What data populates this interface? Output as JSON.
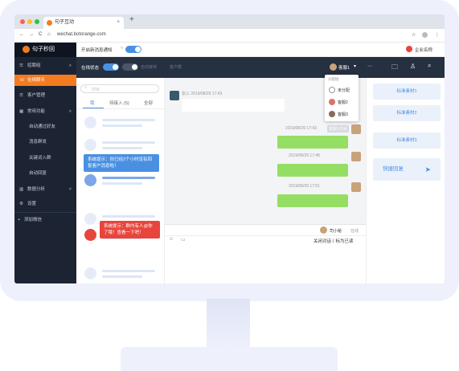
{
  "browser": {
    "tab_title": "句子互动",
    "tab_close": "×",
    "new_tab": "+",
    "url": "wechat.botorange.com",
    "nav_back": "←",
    "nav_forward": "→",
    "nav_reload": "C",
    "nav_home": "⌂",
    "star": "☆",
    "menu": "⋮"
  },
  "app": {
    "logo": "句子秒回",
    "notify_label": "开启新消息通知",
    "company_label": "企业名称",
    "sidebar": {
      "section_label": "招聘组",
      "items": [
        {
          "icon": "☏",
          "label": "在线聊天"
        },
        {
          "icon": "☰",
          "label": "客户管理"
        },
        {
          "icon": "▦",
          "label": "常用功能"
        },
        {
          "label": "自动通过好友"
        },
        {
          "label": "消息群发"
        },
        {
          "label": "关键词入群"
        },
        {
          "label": "自动回复"
        },
        {
          "icon": "▥",
          "label": "数据分析"
        },
        {
          "icon": "⚙",
          "label": "设置"
        },
        {
          "icon": "+",
          "label": "添加微信"
        }
      ]
    },
    "header": {
      "online_label": "在线状态",
      "auto_label": "自动接待",
      "customer_group": "客户群",
      "agent_label": "客服1",
      "dropdown": {
        "title": "分配给",
        "options": [
          "未分配",
          "客服2",
          "客服3"
        ]
      }
    },
    "list": {
      "search_placeholder": "搜索",
      "tabs": [
        "我",
        "待接入 (5)",
        "全部"
      ]
    },
    "popups": [
      {
        "text": "系统提示：你已经2个小时没有回复客户消息啦！",
        "color": "#4a90e2"
      },
      {
        "text": "系统提示：群内有人@你了哦！查看一下吧！",
        "color": "#e8453c"
      }
    ],
    "chat": {
      "incoming_meta": "张三 2019/08/29 17:43",
      "outgoing": [
        {
          "time": "2019/08/29 17:43",
          "badge": "客服1已读"
        },
        {
          "time": "2019/08/29 17:48",
          "badge": ""
        },
        {
          "time": "2019/08/29 17:51",
          "badge": ""
        }
      ],
      "assistant_name": "司小秘",
      "assistant_status": "在线",
      "footer_action": "关闭对话丨标为已读"
    },
    "right_panel": {
      "buttons": [
        "标准素材1",
        "标准素材2",
        "标准素材3"
      ],
      "quick_reply": "快捷回复"
    }
  }
}
